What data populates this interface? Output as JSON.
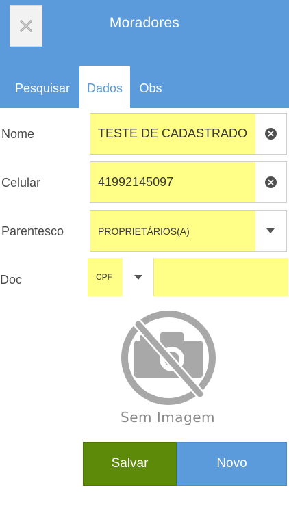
{
  "header": {
    "title": "Moradores"
  },
  "tabs": [
    {
      "label": "Pesquisar",
      "active": false
    },
    {
      "label": "Dados",
      "active": true
    },
    {
      "label": "Obs",
      "active": false
    }
  ],
  "form": {
    "nome": {
      "label": "Nome",
      "value": "TESTE DE CADASTRADO"
    },
    "celular": {
      "label": "Celular",
      "value": "41992145097"
    },
    "parentesco": {
      "label": "Parentesco",
      "value": "PROPRIETÁRIOS(A)"
    },
    "doc": {
      "label": "Doc",
      "type_value": "CPF",
      "value": ""
    }
  },
  "photo": {
    "placeholder_text": "Sem Imagem",
    "icon": "no-camera-icon"
  },
  "buttons": {
    "save_label": "Salvar",
    "new_label": "Novo"
  },
  "colors": {
    "header": "#5b9bdc",
    "field_highlight": "#ffff88",
    "save_button": "#5e8a0a",
    "new_button": "#5b9bdc"
  }
}
